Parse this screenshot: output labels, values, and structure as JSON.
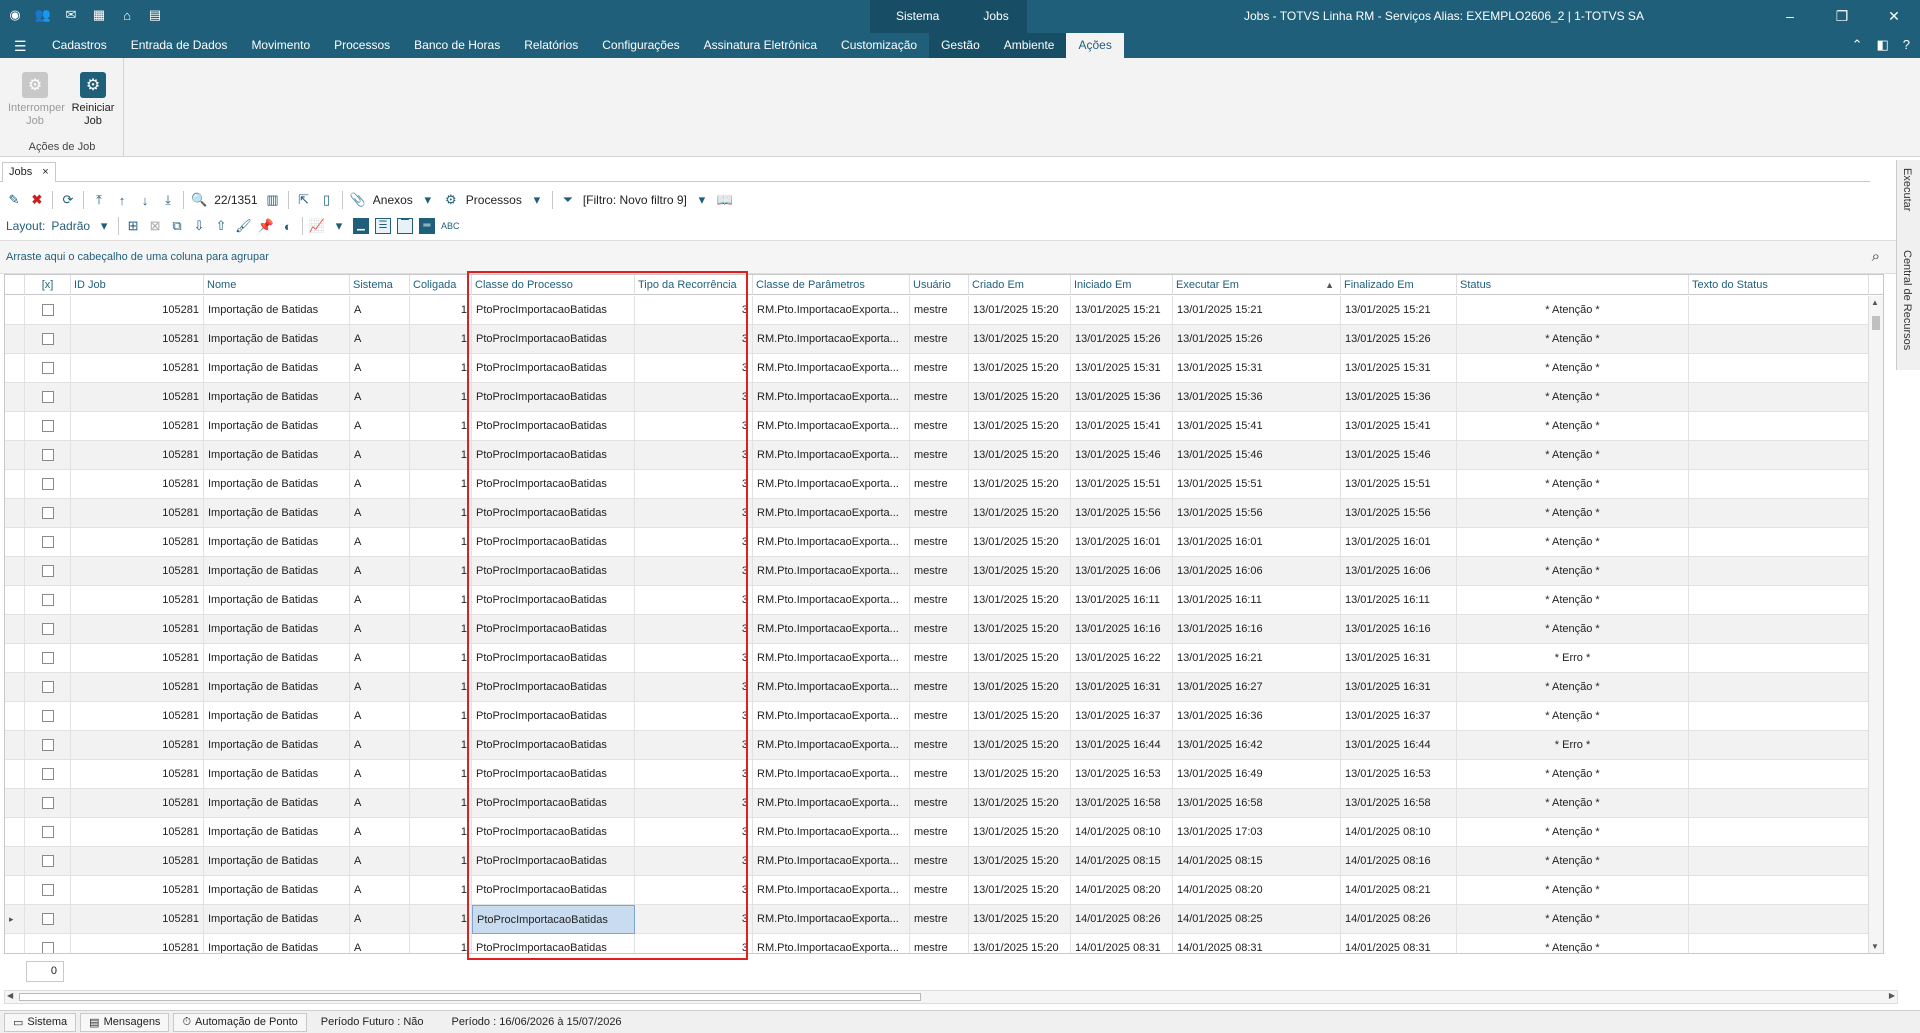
{
  "titlebar": {
    "context_tabs": [
      "Sistema",
      "Jobs"
    ],
    "window_title": "Jobs - TOTVS Linha RM - Serviços  Alias: EXEMPLO2606_2 | 1-TOTVS SA",
    "minimize_glyph": "–",
    "restore_glyph": "❐",
    "close_glyph": "✕"
  },
  "ribbon_tabs": [
    "Cadastros",
    "Entrada de Dados",
    "Movimento",
    "Processos",
    "Banco de Horas",
    "Relatórios",
    "Configurações",
    "Assinatura Eletrônica",
    "Customização",
    "Gestão",
    "Ambiente",
    "Ações"
  ],
  "ribbon": {
    "group_label": "Ações de Job",
    "buttons": [
      {
        "label_line1": "Interromper",
        "label_line2": "Job"
      },
      {
        "label_line1": "Reiniciar",
        "label_line2": "Job"
      }
    ]
  },
  "doc_tab": {
    "label": "Jobs",
    "close": "×"
  },
  "side_tabs": [
    "Executar",
    "Central de Recursos"
  ],
  "toolbar": {
    "record_position": "22/1351",
    "anexos": "Anexos",
    "processos": "Processos",
    "filter": "[Filtro: Novo filtro 9]"
  },
  "layout_bar": {
    "label": "Layout:",
    "value": "Padrão"
  },
  "group_hint": "Arraste aqui o cabeçalho de uma coluna para agrupar",
  "columns": [
    "[x]",
    "ID Job",
    "Nome",
    "Sistema",
    "Coligada",
    "Classe do Processo",
    "Tipo da Recorrência",
    "Classe de Parâmetros",
    "Usuário",
    "Criado Em",
    "Iniciado Em",
    "Executar Em",
    "Finalizado Em",
    "Status",
    "Texto do Status"
  ],
  "rows": [
    {
      "id": "105281",
      "nome": "Importação de Batidas",
      "sistema": "A",
      "coligada": "1",
      "classe": "PtoProcImportacaoBatidas",
      "tipo": "3",
      "param": "RM.Pto.ImportacaoExporta...",
      "usuario": "mestre",
      "criado": "13/01/2025 15:20",
      "iniciado": "13/01/2025 15:21",
      "executar": "13/01/2025 15:21",
      "finalizado": "13/01/2025 15:21",
      "status": "* Atenção *"
    },
    {
      "id": "105281",
      "nome": "Importação de Batidas",
      "sistema": "A",
      "coligada": "1",
      "classe": "PtoProcImportacaoBatidas",
      "tipo": "3",
      "param": "RM.Pto.ImportacaoExporta...",
      "usuario": "mestre",
      "criado": "13/01/2025 15:20",
      "iniciado": "13/01/2025 15:26",
      "executar": "13/01/2025 15:26",
      "finalizado": "13/01/2025 15:26",
      "status": "* Atenção *"
    },
    {
      "id": "105281",
      "nome": "Importação de Batidas",
      "sistema": "A",
      "coligada": "1",
      "classe": "PtoProcImportacaoBatidas",
      "tipo": "3",
      "param": "RM.Pto.ImportacaoExporta...",
      "usuario": "mestre",
      "criado": "13/01/2025 15:20",
      "iniciado": "13/01/2025 15:31",
      "executar": "13/01/2025 15:31",
      "finalizado": "13/01/2025 15:31",
      "status": "* Atenção *"
    },
    {
      "id": "105281",
      "nome": "Importação de Batidas",
      "sistema": "A",
      "coligada": "1",
      "classe": "PtoProcImportacaoBatidas",
      "tipo": "3",
      "param": "RM.Pto.ImportacaoExporta...",
      "usuario": "mestre",
      "criado": "13/01/2025 15:20",
      "iniciado": "13/01/2025 15:36",
      "executar": "13/01/2025 15:36",
      "finalizado": "13/01/2025 15:36",
      "status": "* Atenção *"
    },
    {
      "id": "105281",
      "nome": "Importação de Batidas",
      "sistema": "A",
      "coligada": "1",
      "classe": "PtoProcImportacaoBatidas",
      "tipo": "3",
      "param": "RM.Pto.ImportacaoExporta...",
      "usuario": "mestre",
      "criado": "13/01/2025 15:20",
      "iniciado": "13/01/2025 15:41",
      "executar": "13/01/2025 15:41",
      "finalizado": "13/01/2025 15:41",
      "status": "* Atenção *"
    },
    {
      "id": "105281",
      "nome": "Importação de Batidas",
      "sistema": "A",
      "coligada": "1",
      "classe": "PtoProcImportacaoBatidas",
      "tipo": "3",
      "param": "RM.Pto.ImportacaoExporta...",
      "usuario": "mestre",
      "criado": "13/01/2025 15:20",
      "iniciado": "13/01/2025 15:46",
      "executar": "13/01/2025 15:46",
      "finalizado": "13/01/2025 15:46",
      "status": "* Atenção *"
    },
    {
      "id": "105281",
      "nome": "Importação de Batidas",
      "sistema": "A",
      "coligada": "1",
      "classe": "PtoProcImportacaoBatidas",
      "tipo": "3",
      "param": "RM.Pto.ImportacaoExporta...",
      "usuario": "mestre",
      "criado": "13/01/2025 15:20",
      "iniciado": "13/01/2025 15:51",
      "executar": "13/01/2025 15:51",
      "finalizado": "13/01/2025 15:51",
      "status": "* Atenção *"
    },
    {
      "id": "105281",
      "nome": "Importação de Batidas",
      "sistema": "A",
      "coligada": "1",
      "classe": "PtoProcImportacaoBatidas",
      "tipo": "3",
      "param": "RM.Pto.ImportacaoExporta...",
      "usuario": "mestre",
      "criado": "13/01/2025 15:20",
      "iniciado": "13/01/2025 15:56",
      "executar": "13/01/2025 15:56",
      "finalizado": "13/01/2025 15:56",
      "status": "* Atenção *"
    },
    {
      "id": "105281",
      "nome": "Importação de Batidas",
      "sistema": "A",
      "coligada": "1",
      "classe": "PtoProcImportacaoBatidas",
      "tipo": "3",
      "param": "RM.Pto.ImportacaoExporta...",
      "usuario": "mestre",
      "criado": "13/01/2025 15:20",
      "iniciado": "13/01/2025 16:01",
      "executar": "13/01/2025 16:01",
      "finalizado": "13/01/2025 16:01",
      "status": "* Atenção *"
    },
    {
      "id": "105281",
      "nome": "Importação de Batidas",
      "sistema": "A",
      "coligada": "1",
      "classe": "PtoProcImportacaoBatidas",
      "tipo": "3",
      "param": "RM.Pto.ImportacaoExporta...",
      "usuario": "mestre",
      "criado": "13/01/2025 15:20",
      "iniciado": "13/01/2025 16:06",
      "executar": "13/01/2025 16:06",
      "finalizado": "13/01/2025 16:06",
      "status": "* Atenção *"
    },
    {
      "id": "105281",
      "nome": "Importação de Batidas",
      "sistema": "A",
      "coligada": "1",
      "classe": "PtoProcImportacaoBatidas",
      "tipo": "3",
      "param": "RM.Pto.ImportacaoExporta...",
      "usuario": "mestre",
      "criado": "13/01/2025 15:20",
      "iniciado": "13/01/2025 16:11",
      "executar": "13/01/2025 16:11",
      "finalizado": "13/01/2025 16:11",
      "status": "* Atenção *"
    },
    {
      "id": "105281",
      "nome": "Importação de Batidas",
      "sistema": "A",
      "coligada": "1",
      "classe": "PtoProcImportacaoBatidas",
      "tipo": "3",
      "param": "RM.Pto.ImportacaoExporta...",
      "usuario": "mestre",
      "criado": "13/01/2025 15:20",
      "iniciado": "13/01/2025 16:16",
      "executar": "13/01/2025 16:16",
      "finalizado": "13/01/2025 16:16",
      "status": "* Atenção *"
    },
    {
      "id": "105281",
      "nome": "Importação de Batidas",
      "sistema": "A",
      "coligada": "1",
      "classe": "PtoProcImportacaoBatidas",
      "tipo": "3",
      "param": "RM.Pto.ImportacaoExporta...",
      "usuario": "mestre",
      "criado": "13/01/2025 15:20",
      "iniciado": "13/01/2025 16:22",
      "executar": "13/01/2025 16:21",
      "finalizado": "13/01/2025 16:31",
      "status": "* Erro *"
    },
    {
      "id": "105281",
      "nome": "Importação de Batidas",
      "sistema": "A",
      "coligada": "1",
      "classe": "PtoProcImportacaoBatidas",
      "tipo": "3",
      "param": "RM.Pto.ImportacaoExporta...",
      "usuario": "mestre",
      "criado": "13/01/2025 15:20",
      "iniciado": "13/01/2025 16:31",
      "executar": "13/01/2025 16:27",
      "finalizado": "13/01/2025 16:31",
      "status": "* Atenção *"
    },
    {
      "id": "105281",
      "nome": "Importação de Batidas",
      "sistema": "A",
      "coligada": "1",
      "classe": "PtoProcImportacaoBatidas",
      "tipo": "3",
      "param": "RM.Pto.ImportacaoExporta...",
      "usuario": "mestre",
      "criado": "13/01/2025 15:20",
      "iniciado": "13/01/2025 16:37",
      "executar": "13/01/2025 16:36",
      "finalizado": "13/01/2025 16:37",
      "status": "* Atenção *"
    },
    {
      "id": "105281",
      "nome": "Importação de Batidas",
      "sistema": "A",
      "coligada": "1",
      "classe": "PtoProcImportacaoBatidas",
      "tipo": "3",
      "param": "RM.Pto.ImportacaoExporta...",
      "usuario": "mestre",
      "criado": "13/01/2025 15:20",
      "iniciado": "13/01/2025 16:44",
      "executar": "13/01/2025 16:42",
      "finalizado": "13/01/2025 16:44",
      "status": "* Erro *"
    },
    {
      "id": "105281",
      "nome": "Importação de Batidas",
      "sistema": "A",
      "coligada": "1",
      "classe": "PtoProcImportacaoBatidas",
      "tipo": "3",
      "param": "RM.Pto.ImportacaoExporta...",
      "usuario": "mestre",
      "criado": "13/01/2025 15:20",
      "iniciado": "13/01/2025 16:53",
      "executar": "13/01/2025 16:49",
      "finalizado": "13/01/2025 16:53",
      "status": "* Atenção *"
    },
    {
      "id": "105281",
      "nome": "Importação de Batidas",
      "sistema": "A",
      "coligada": "1",
      "classe": "PtoProcImportacaoBatidas",
      "tipo": "3",
      "param": "RM.Pto.ImportacaoExporta...",
      "usuario": "mestre",
      "criado": "13/01/2025 15:20",
      "iniciado": "13/01/2025 16:58",
      "executar": "13/01/2025 16:58",
      "finalizado": "13/01/2025 16:58",
      "status": "* Atenção *"
    },
    {
      "id": "105281",
      "nome": "Importação de Batidas",
      "sistema": "A",
      "coligada": "1",
      "classe": "PtoProcImportacaoBatidas",
      "tipo": "3",
      "param": "RM.Pto.ImportacaoExporta...",
      "usuario": "mestre",
      "criado": "13/01/2025 15:20",
      "iniciado": "14/01/2025 08:10",
      "executar": "13/01/2025 17:03",
      "finalizado": "14/01/2025 08:10",
      "status": "* Atenção *"
    },
    {
      "id": "105281",
      "nome": "Importação de Batidas",
      "sistema": "A",
      "coligada": "1",
      "classe": "PtoProcImportacaoBatidas",
      "tipo": "3",
      "param": "RM.Pto.ImportacaoExporta...",
      "usuario": "mestre",
      "criado": "13/01/2025 15:20",
      "iniciado": "14/01/2025 08:15",
      "executar": "14/01/2025 08:15",
      "finalizado": "14/01/2025 08:16",
      "status": "* Atenção *"
    },
    {
      "id": "105281",
      "nome": "Importação de Batidas",
      "sistema": "A",
      "coligada": "1",
      "classe": "PtoProcImportacaoBatidas",
      "tipo": "3",
      "param": "RM.Pto.ImportacaoExporta...",
      "usuario": "mestre",
      "criado": "13/01/2025 15:20",
      "iniciado": "14/01/2025 08:20",
      "executar": "14/01/2025 08:20",
      "finalizado": "14/01/2025 08:21",
      "status": "* Atenção *"
    },
    {
      "id": "105281",
      "nome": "Importação de Batidas",
      "sistema": "A",
      "coligada": "1",
      "classe": "PtoProcImportacaoBatidas",
      "tipo": "3",
      "param": "RM.Pto.ImportacaoExporta...",
      "usuario": "mestre",
      "criado": "13/01/2025 15:20",
      "iniciado": "14/01/2025 08:26",
      "executar": "14/01/2025 08:25",
      "finalizado": "14/01/2025 08:26",
      "status": "* Atenção *"
    },
    {
      "id": "105281",
      "nome": "Importação de Batidas",
      "sistema": "A",
      "coligada": "1",
      "classe": "PtoProcImportacaoBatidas",
      "tipo": "3",
      "param": "RM.Pto.ImportacaoExporta...",
      "usuario": "mestre",
      "criado": "13/01/2025 15:20",
      "iniciado": "14/01/2025 08:31",
      "executar": "14/01/2025 08:31",
      "finalizado": "14/01/2025 08:31",
      "status": "* Atenção *"
    }
  ],
  "current_row_marker": "▸",
  "footer_count": "0",
  "statusbar": {
    "items": [
      "Sistema",
      "Mensagens",
      "Automação de Ponto"
    ],
    "periodo_futuro": "Período Futuro : Não",
    "periodo": "Período : 16/06/2026 à 15/07/2026"
  },
  "colors": {
    "accent": "#1f5f7a",
    "highlight_box": "#e0201e",
    "selected_cell": "#c9dcef"
  }
}
